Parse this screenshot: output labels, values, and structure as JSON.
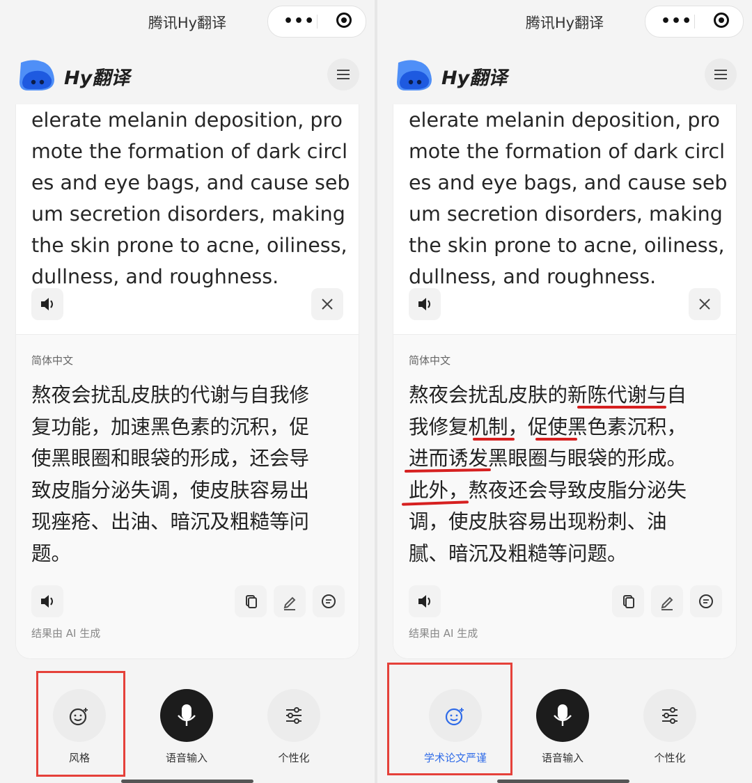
{
  "top_bar": {
    "title": "腾讯Hy翻译"
  },
  "app": {
    "name": "Hy翻译"
  },
  "source": {
    "lines": [
      "elerate melanin deposition, pro",
      "mote the formation of dark circl",
      "es and eye bags, and cause seb",
      "um secretion disorders, making",
      "the skin prone to acne, oiliness,",
      "dullness, and roughness."
    ]
  },
  "target_language": "简体中文",
  "left": {
    "translation_lines": [
      "熬夜会扰乱皮肤的代谢与自我修",
      "复功能，加速黑色素的沉积，促",
      "使黑眼圈和眼袋的形成，还会导",
      "致皮脂分泌失调，使皮肤容易出",
      "现痤疮、出油、暗沉及粗糙等问",
      "题。"
    ],
    "style_label": "风格"
  },
  "right": {
    "translation_lines": [
      "熬夜会扰乱皮肤的新陈代谢与自",
      "我修复机制，促使黑色素沉积，",
      "进而诱发黑眼圈与眼袋的形成。",
      "此外，熬夜还会导致皮脂分泌失",
      "调，使皮肤容易出现粉刺、油",
      "腻、暗沉及粗糙等问题。"
    ],
    "style_label": "学术论文严谨"
  },
  "ai_note": "结果由 AI 生成",
  "voice_label": "语音输入",
  "personalize_label": "个性化",
  "colors": {
    "accent_blue": "#2f6be8",
    "annotation_red": "#d62020"
  }
}
